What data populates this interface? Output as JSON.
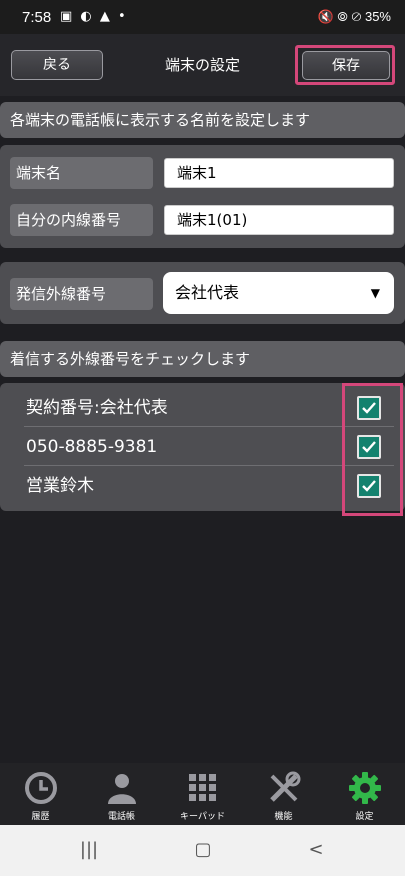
{
  "status_bar": {
    "time": "7:58",
    "icons": "▣ ◐ ▲ •",
    "right": "🔇 ⦾ ⊘ 35%"
  },
  "header": {
    "back_label": "戻る",
    "title": "端末の設定",
    "save_label": "保存"
  },
  "name_section": {
    "heading": "各端末の電話帳に表示する名前を設定します",
    "rows": [
      {
        "label": "端末名",
        "value": "端末1"
      },
      {
        "label": "自分の内線番号",
        "value": "端末1(01)"
      }
    ]
  },
  "outgoing": {
    "label": "発信外線番号",
    "selected": "会社代表"
  },
  "incoming_section": {
    "heading": "着信する外線番号をチェックします",
    "items": [
      {
        "label": "契約番号:会社代表",
        "checked": true
      },
      {
        "label": "050-8885-9381",
        "checked": true
      },
      {
        "label": "営業鈴木",
        "checked": true
      }
    ]
  },
  "tabs": [
    {
      "label": "履歴",
      "icon": "clock-icon"
    },
    {
      "label": "電話帳",
      "icon": "person-icon"
    },
    {
      "label": "キーパッド",
      "icon": "keypad-icon"
    },
    {
      "label": "機能",
      "icon": "tools-icon"
    },
    {
      "label": "設定",
      "icon": "gear-icon",
      "active": true
    }
  ],
  "colors": {
    "accent_green": "#32b84a",
    "highlight": "#d4477a",
    "checkbox": "#14826f"
  }
}
